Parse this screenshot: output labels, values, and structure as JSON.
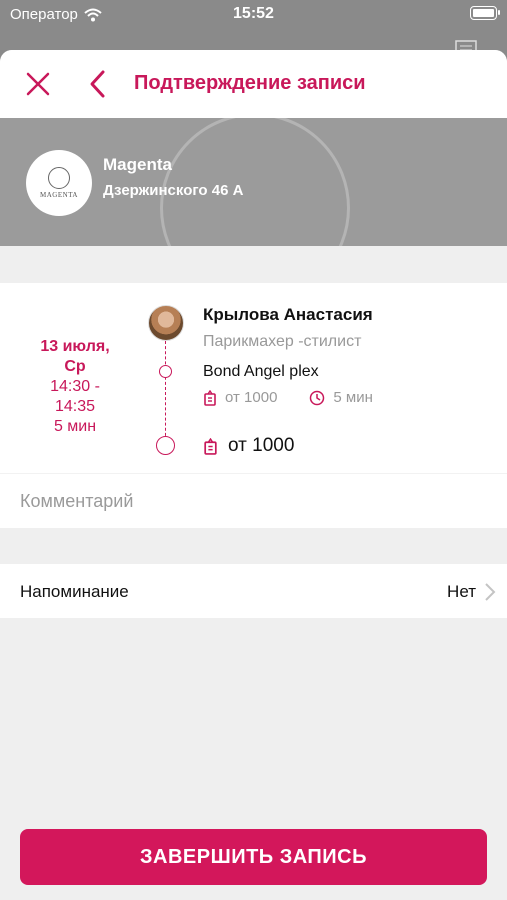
{
  "status_bar": {
    "carrier": "Оператор",
    "time": "15:52"
  },
  "header": {
    "title": "Подтверждение записи"
  },
  "salon": {
    "name": "Magenta",
    "address": "Дзержинского 46 А",
    "logo_text": "MAGENTA"
  },
  "booking": {
    "date_line1": "13 июля,",
    "date_line2": "Ср",
    "time_line1": "14:30 -",
    "time_line2": "14:35",
    "duration": "5 мин",
    "master_name": "Крылова Анастасия",
    "master_role": "Парикмахер -стилист",
    "service_name": "Bond Angel plex",
    "service_price": "от 1000",
    "service_duration": "5 мин",
    "total_price": "от 1000"
  },
  "comment": {
    "placeholder": "Комментарий"
  },
  "reminder": {
    "label": "Напоминание",
    "value": "Нет"
  },
  "submit": {
    "label": "ЗАВЕРШИТЬ ЗАПИСЬ"
  },
  "colors": {
    "accent": "#c8185a",
    "button": "#d3175b"
  }
}
